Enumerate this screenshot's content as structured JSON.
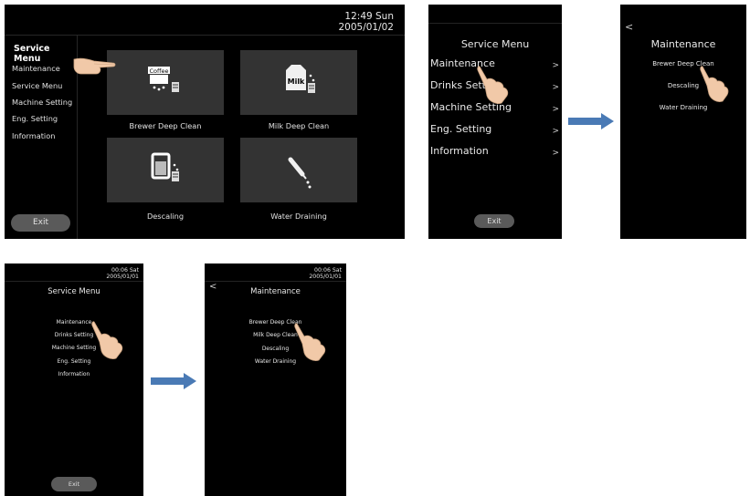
{
  "screen_a": {
    "clock_time": "12:49  Sun",
    "clock_date": "2005/01/02",
    "menu_title": "Service Menu",
    "menu_items": [
      "Maintenance",
      "Service Menu",
      "Machine Setting",
      "Eng. Setting",
      "Information"
    ],
    "tiles": [
      "Brewer Deep Clean",
      "Milk Deep Clean",
      "Descaling",
      "Water Draining"
    ],
    "tile_icon_labels": [
      "Coffee",
      "Milk"
    ],
    "exit_label": "Exit"
  },
  "screen_b": {
    "title": "Service Menu",
    "items": [
      "Maintenance",
      "Drinks Setting",
      "Machine Setting",
      "Eng. Setting",
      "Information"
    ],
    "chevron": ">",
    "exit_label": "Exit"
  },
  "screen_c": {
    "back": "<",
    "title": "Maintenance",
    "items": [
      "Brewer Deep Clean",
      "Descaling",
      "Water Draining"
    ]
  },
  "screen_d": {
    "clock_time": "00:06  Sat",
    "clock_date": "2005/01/01",
    "title": "Service Menu",
    "items": [
      "Maintenance",
      "Drinks Setting",
      "Machine Setting",
      "Eng. Setting",
      "Information"
    ],
    "exit_label": "Exit"
  },
  "screen_e": {
    "clock_time": "00:06  Sat",
    "clock_date": "2005/01/01",
    "back": "<",
    "title": "Maintenance",
    "items": [
      "Brewer Deep Clean",
      "Milk Deep Clean",
      "Descaling",
      "Water Draining"
    ]
  },
  "colors": {
    "screen_bg": "#000000",
    "tile_bg": "#333333",
    "button_bg": "#5a5a5a",
    "arrow": "#4a7ab5"
  },
  "icons": [
    "pointing-hand-icon",
    "coffee-machine-icon",
    "milk-carton-icon",
    "descaling-icon",
    "water-draining-icon",
    "right-arrow-icon",
    "back-chevron-icon"
  ]
}
